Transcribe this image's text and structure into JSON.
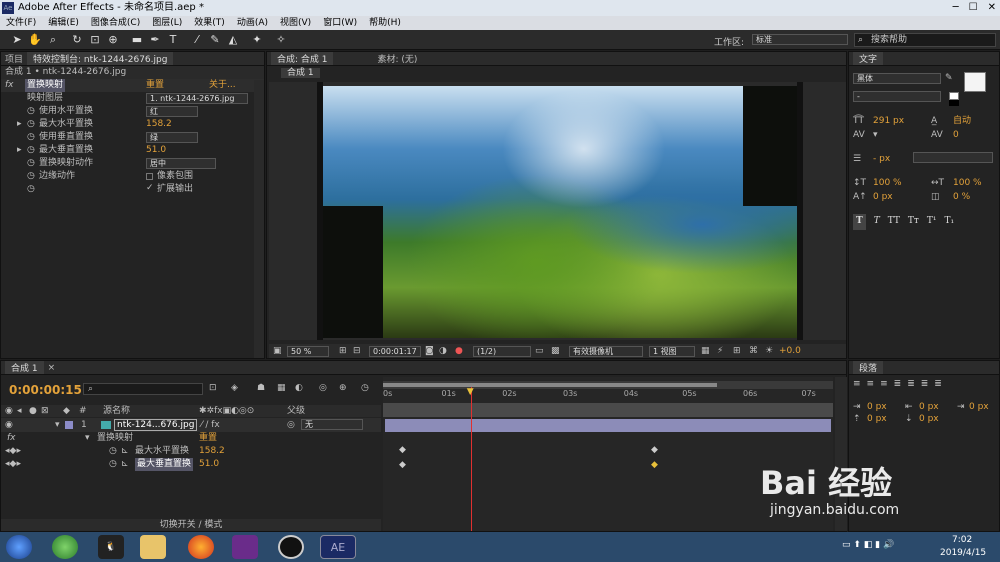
{
  "window": {
    "title": "Adobe After Effects - 未命名项目.aep *",
    "app_badge": "Ae"
  },
  "menu": [
    "文件(F)",
    "编辑(E)",
    "图像合成(C)",
    "图层(L)",
    "效果(T)",
    "动画(A)",
    "视图(V)",
    "窗口(W)",
    "帮助(H)"
  ],
  "toolbar": {
    "workspace_label": "工作区:",
    "workspace_value": "标准",
    "search_placeholder": "搜索帮助"
  },
  "left_panel": {
    "tabs": [
      "项目",
      "特效控制台: ntk-1244-2676.jpg"
    ],
    "breadcrumb": "合成 1 • ntk-1244-2676.jpg",
    "effect": {
      "name": "置换映射",
      "reset": "重置",
      "about": "关于..."
    },
    "properties": [
      {
        "label": "映射图层",
        "value": "1. ntk-1244-2676.jpg",
        "type": "dropdown"
      },
      {
        "label": "使用水平置换",
        "value": "红",
        "type": "dropdown"
      },
      {
        "label": "最大水平置换",
        "value": "158.2",
        "type": "number"
      },
      {
        "label": "使用垂直置换",
        "value": "绿",
        "type": "dropdown"
      },
      {
        "label": "最大垂直置换",
        "value": "51.0",
        "type": "number"
      },
      {
        "label": "置换映射动作",
        "value": "居中",
        "type": "dropdown"
      },
      {
        "label": "边缘动作",
        "value": "像素包围",
        "type": "checkbox",
        "checked": false
      },
      {
        "label": "",
        "value": "扩展输出",
        "type": "checkbox",
        "checked": true
      }
    ]
  },
  "viewer": {
    "tabs": [
      "合成: 合成 1",
      "素材: (无)"
    ],
    "subtab": "合成 1",
    "footer": {
      "zoom": "50 %",
      "timecode": "0:00:01:17",
      "resolution": "(1/2)",
      "camera": "有效摄像机",
      "views": "1 视图",
      "exposure": "+0.0"
    }
  },
  "right_panel": {
    "text_tab": "文字",
    "font": "黑体",
    "font_size": "291 px",
    "leading": "自动",
    "tracking": "0",
    "stroke": "- px",
    "v_scale": "100 %",
    "h_scale": "100 %",
    "baseline": "0 px",
    "tsume": "0 %",
    "styles": [
      "T",
      "T",
      "TT",
      "Tт",
      "T¹",
      "T₁"
    ],
    "para_tab": "段落",
    "indent": [
      "0 px",
      "0 px",
      "0 px",
      "0 px",
      "0 px"
    ]
  },
  "timeline": {
    "tab": "合成 1",
    "timecode": "0:00:00:15",
    "columns": {
      "source": "源名称",
      "parent": "父级"
    },
    "layer": {
      "index": "1",
      "name": "ntk-124...676.jpg",
      "parent": "无"
    },
    "effect_row": {
      "name": "置换映射",
      "reset": "重置"
    },
    "keyed_props": [
      {
        "label": "最大水平置换",
        "value": "158.2"
      },
      {
        "label": "最大垂直置换",
        "value": "51.0"
      }
    ],
    "ruler": [
      "0s",
      "01s",
      "02s",
      "03s",
      "04s",
      "05s",
      "06s",
      "07s"
    ],
    "playhead_fraction": 0.195,
    "switch_label": "切换开关 / 模式"
  },
  "taskbar": {
    "time": "7:02",
    "date": "2019/4/15",
    "ae_label": "AE"
  },
  "watermark": {
    "brand": "Bai 经验",
    "url": "jingyan.baidu.com"
  }
}
